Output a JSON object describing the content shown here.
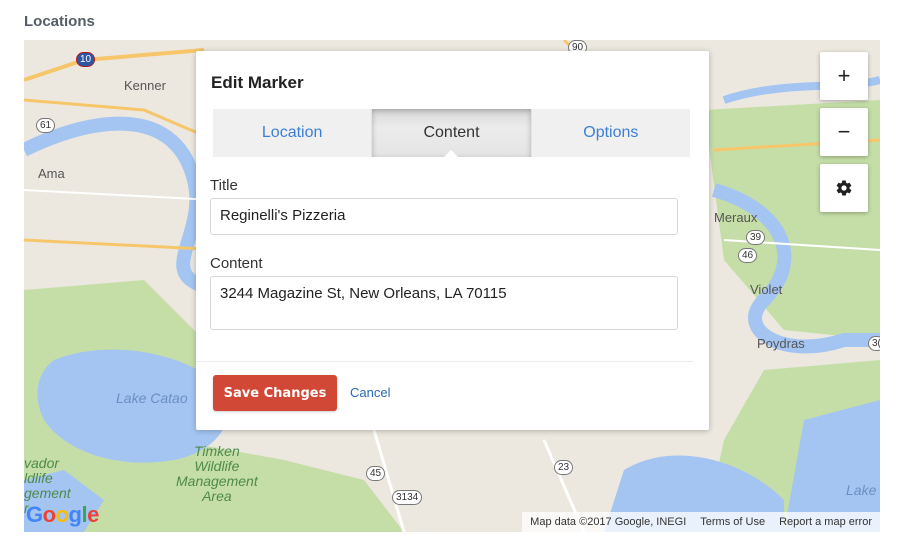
{
  "section": {
    "title": "Locations"
  },
  "map": {
    "labels": {
      "kenner": "Kenner",
      "ama": "Ama",
      "meraux": "Meraux",
      "violet": "Violet",
      "poydras": "Poydras",
      "lake_cataouatche": "Lake Catao",
      "timken": "Timken\nWildlife\nManagement\nArea",
      "salvador": "vador\nldlife\ngement\nr",
      "lake": "Lake"
    },
    "shields": {
      "i10": "10",
      "us61": "61",
      "us90": "90",
      "r39": "39",
      "r46": "46",
      "r45": "45",
      "r23": "23",
      "r3134": "3134",
      "r3": "3("
    },
    "google_logo": "Google",
    "attribution": {
      "data": "Map data ©2017 Google, INEGI",
      "terms": "Terms of Use",
      "report": "Report a map error"
    },
    "controls": {
      "zoom_in": "+",
      "zoom_out": "−",
      "settings_icon": "gear-icon"
    }
  },
  "modal": {
    "title": "Edit Marker",
    "tabs": [
      {
        "label": "Location"
      },
      {
        "label": "Content",
        "active": true
      },
      {
        "label": "Options"
      }
    ],
    "fields": {
      "title_label": "Title",
      "title_value": "Reginelli's Pizzeria",
      "content_label": "Content",
      "content_value": "3244 Magazine St, New Orleans, LA 70115"
    },
    "save_label": "Save Changes",
    "cancel_label": "Cancel"
  },
  "colors": {
    "save_button": "#d14836",
    "link": "#3d7fd6",
    "water": "#a4c5f2",
    "park": "#c5dea8"
  }
}
